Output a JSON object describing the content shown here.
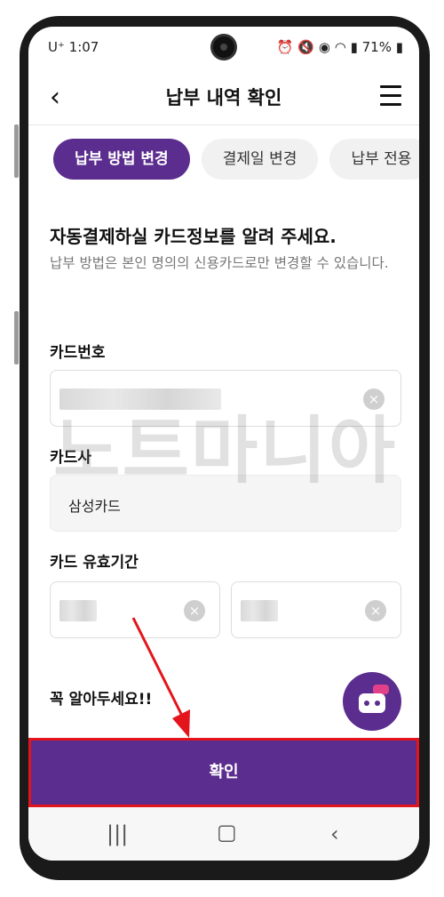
{
  "status_bar": {
    "left": "U⁺ 1:07 ",
    "right": "71%"
  },
  "header": {
    "title": "납부 내역 확인"
  },
  "tabs": [
    {
      "label": "납부 방법 변경"
    },
    {
      "label": "결제일 변경"
    },
    {
      "label": "납부 전용"
    }
  ],
  "form": {
    "heading": "자동결제하실 카드정보를 알려 주세요.",
    "description": "납부 방법은 본인 명의의 신용카드로만 변경할 수 있습니다.",
    "card_number_label": "카드번호",
    "card_company_label": "카드사",
    "card_company_value": "삼성카드",
    "expiry_label": "카드 유효기간"
  },
  "watermark": "노트마니아",
  "notice": "꼭 알아두세요!!",
  "confirm_label": "확인",
  "colors": {
    "accent": "#5b2d8e",
    "highlight": "#e3141b"
  }
}
